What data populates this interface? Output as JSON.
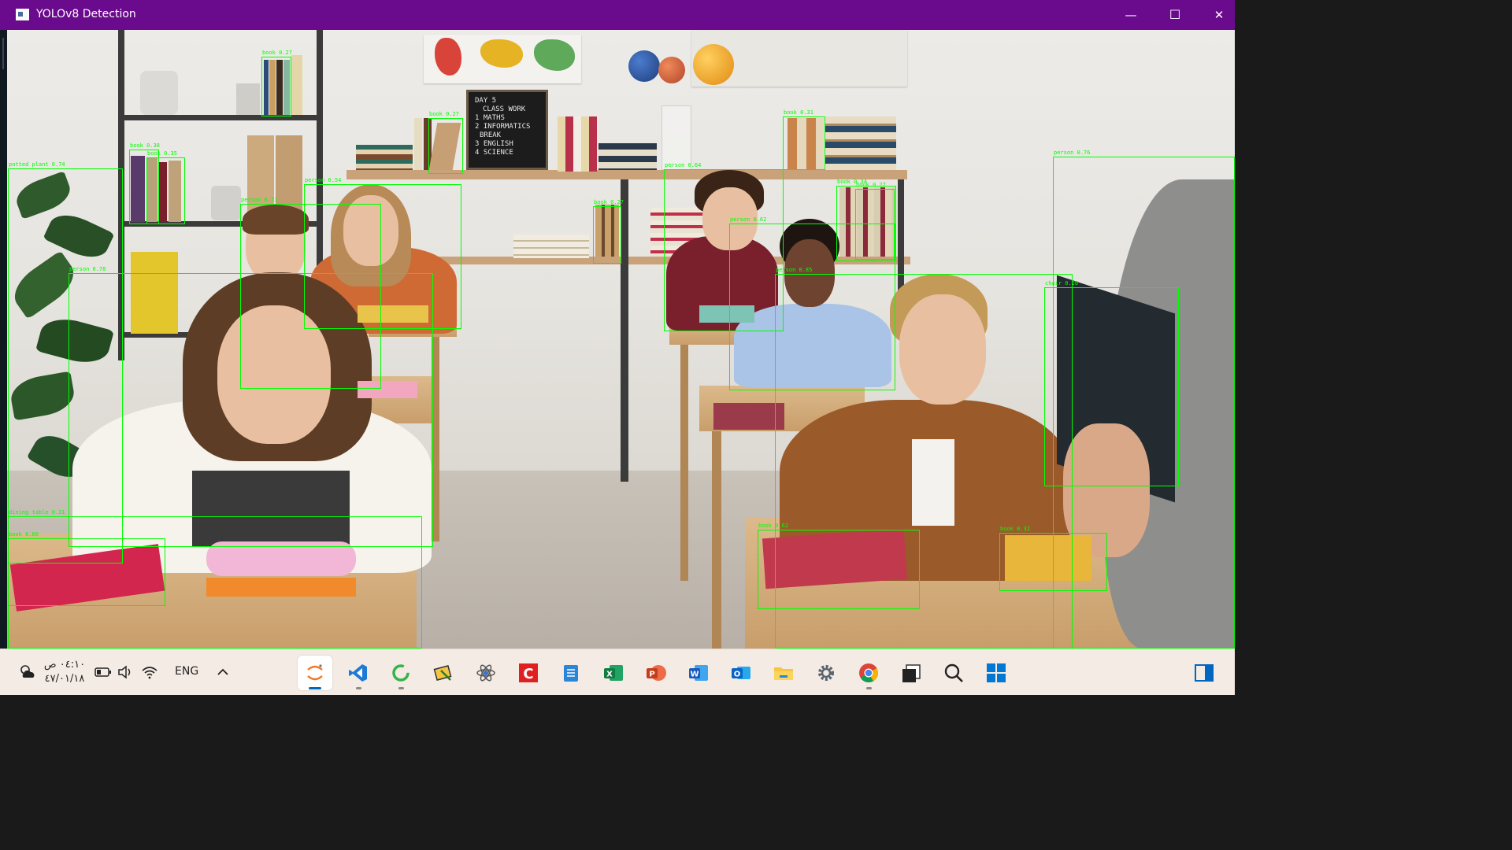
{
  "window": {
    "title": "YOLOv8 Detection",
    "controls": {
      "minimize": "—",
      "maximize": "☐",
      "close": "✕"
    },
    "titlebar_color": "#6a0a8c"
  },
  "detections": [
    {
      "label": "book 0.27",
      "class": "book"
    },
    {
      "label": "book 0.27",
      "class": "book"
    },
    {
      "label": "book 0.31",
      "class": "book"
    },
    {
      "label": "person 0.76",
      "class": "person"
    },
    {
      "label": "book 0.38",
      "class": "book"
    },
    {
      "label": "book 0.35",
      "class": "book"
    },
    {
      "label": "potted plant 0.74",
      "class": "potted plant"
    },
    {
      "label": "person 0.54",
      "class": "person"
    },
    {
      "label": "person 0.71",
      "class": "person"
    },
    {
      "label": "book 0.27",
      "class": "book"
    },
    {
      "label": "person 0.64",
      "class": "person"
    },
    {
      "label": "person 0.62",
      "class": "person"
    },
    {
      "label": "book 0.34",
      "class": "book"
    },
    {
      "label": "book 0.27",
      "class": "book"
    },
    {
      "label": "person 0.78",
      "class": "person"
    },
    {
      "label": "person 0.85",
      "class": "person"
    },
    {
      "label": "chair 0.28",
      "class": "chair"
    },
    {
      "label": "dining table 0.31",
      "class": "dining table"
    },
    {
      "label": "book 0.66",
      "class": "book"
    },
    {
      "label": "book 0.62",
      "class": "book"
    },
    {
      "label": "book 0.32",
      "class": "book"
    }
  ],
  "blackboard": {
    "lines": [
      "DAY 5",
      "CLASS WORK",
      "1 MATHS",
      "2 INFORMATICS",
      "BREAK",
      "3 ENGLISH",
      "4 SCIENCE"
    ]
  },
  "taskbar": {
    "time": "٠٤:١٠ ص",
    "date": "٤٧/٠١/١٨",
    "language": "ENG",
    "tray_icons": [
      "weather-icon",
      "battery-icon",
      "volume-icon",
      "wifi-icon",
      "chevron-up-icon"
    ],
    "apps": [
      {
        "name": "jupyter",
        "active": true,
        "running": true
      },
      {
        "name": "vscode",
        "active": false,
        "running": true
      },
      {
        "name": "spinner-app",
        "active": false,
        "running": true
      },
      {
        "name": "snipping",
        "active": false,
        "running": false
      },
      {
        "name": "atom-app",
        "active": false,
        "running": false
      },
      {
        "name": "c-app",
        "active": false,
        "running": false
      },
      {
        "name": "notepad",
        "active": false,
        "running": false
      },
      {
        "name": "excel",
        "active": false,
        "running": false
      },
      {
        "name": "powerpoint",
        "active": false,
        "running": false
      },
      {
        "name": "word",
        "active": false,
        "running": false
      },
      {
        "name": "outlook",
        "active": false,
        "running": false
      },
      {
        "name": "file-explorer",
        "active": false,
        "running": false
      },
      {
        "name": "settings",
        "active": false,
        "running": false
      },
      {
        "name": "chrome",
        "active": false,
        "running": true
      },
      {
        "name": "terminal",
        "active": false,
        "running": false
      },
      {
        "name": "search",
        "active": false,
        "running": false
      },
      {
        "name": "start",
        "active": false,
        "running": false
      }
    ]
  },
  "colors": {
    "detection": "#00ff00",
    "accent": "#0067c0"
  }
}
